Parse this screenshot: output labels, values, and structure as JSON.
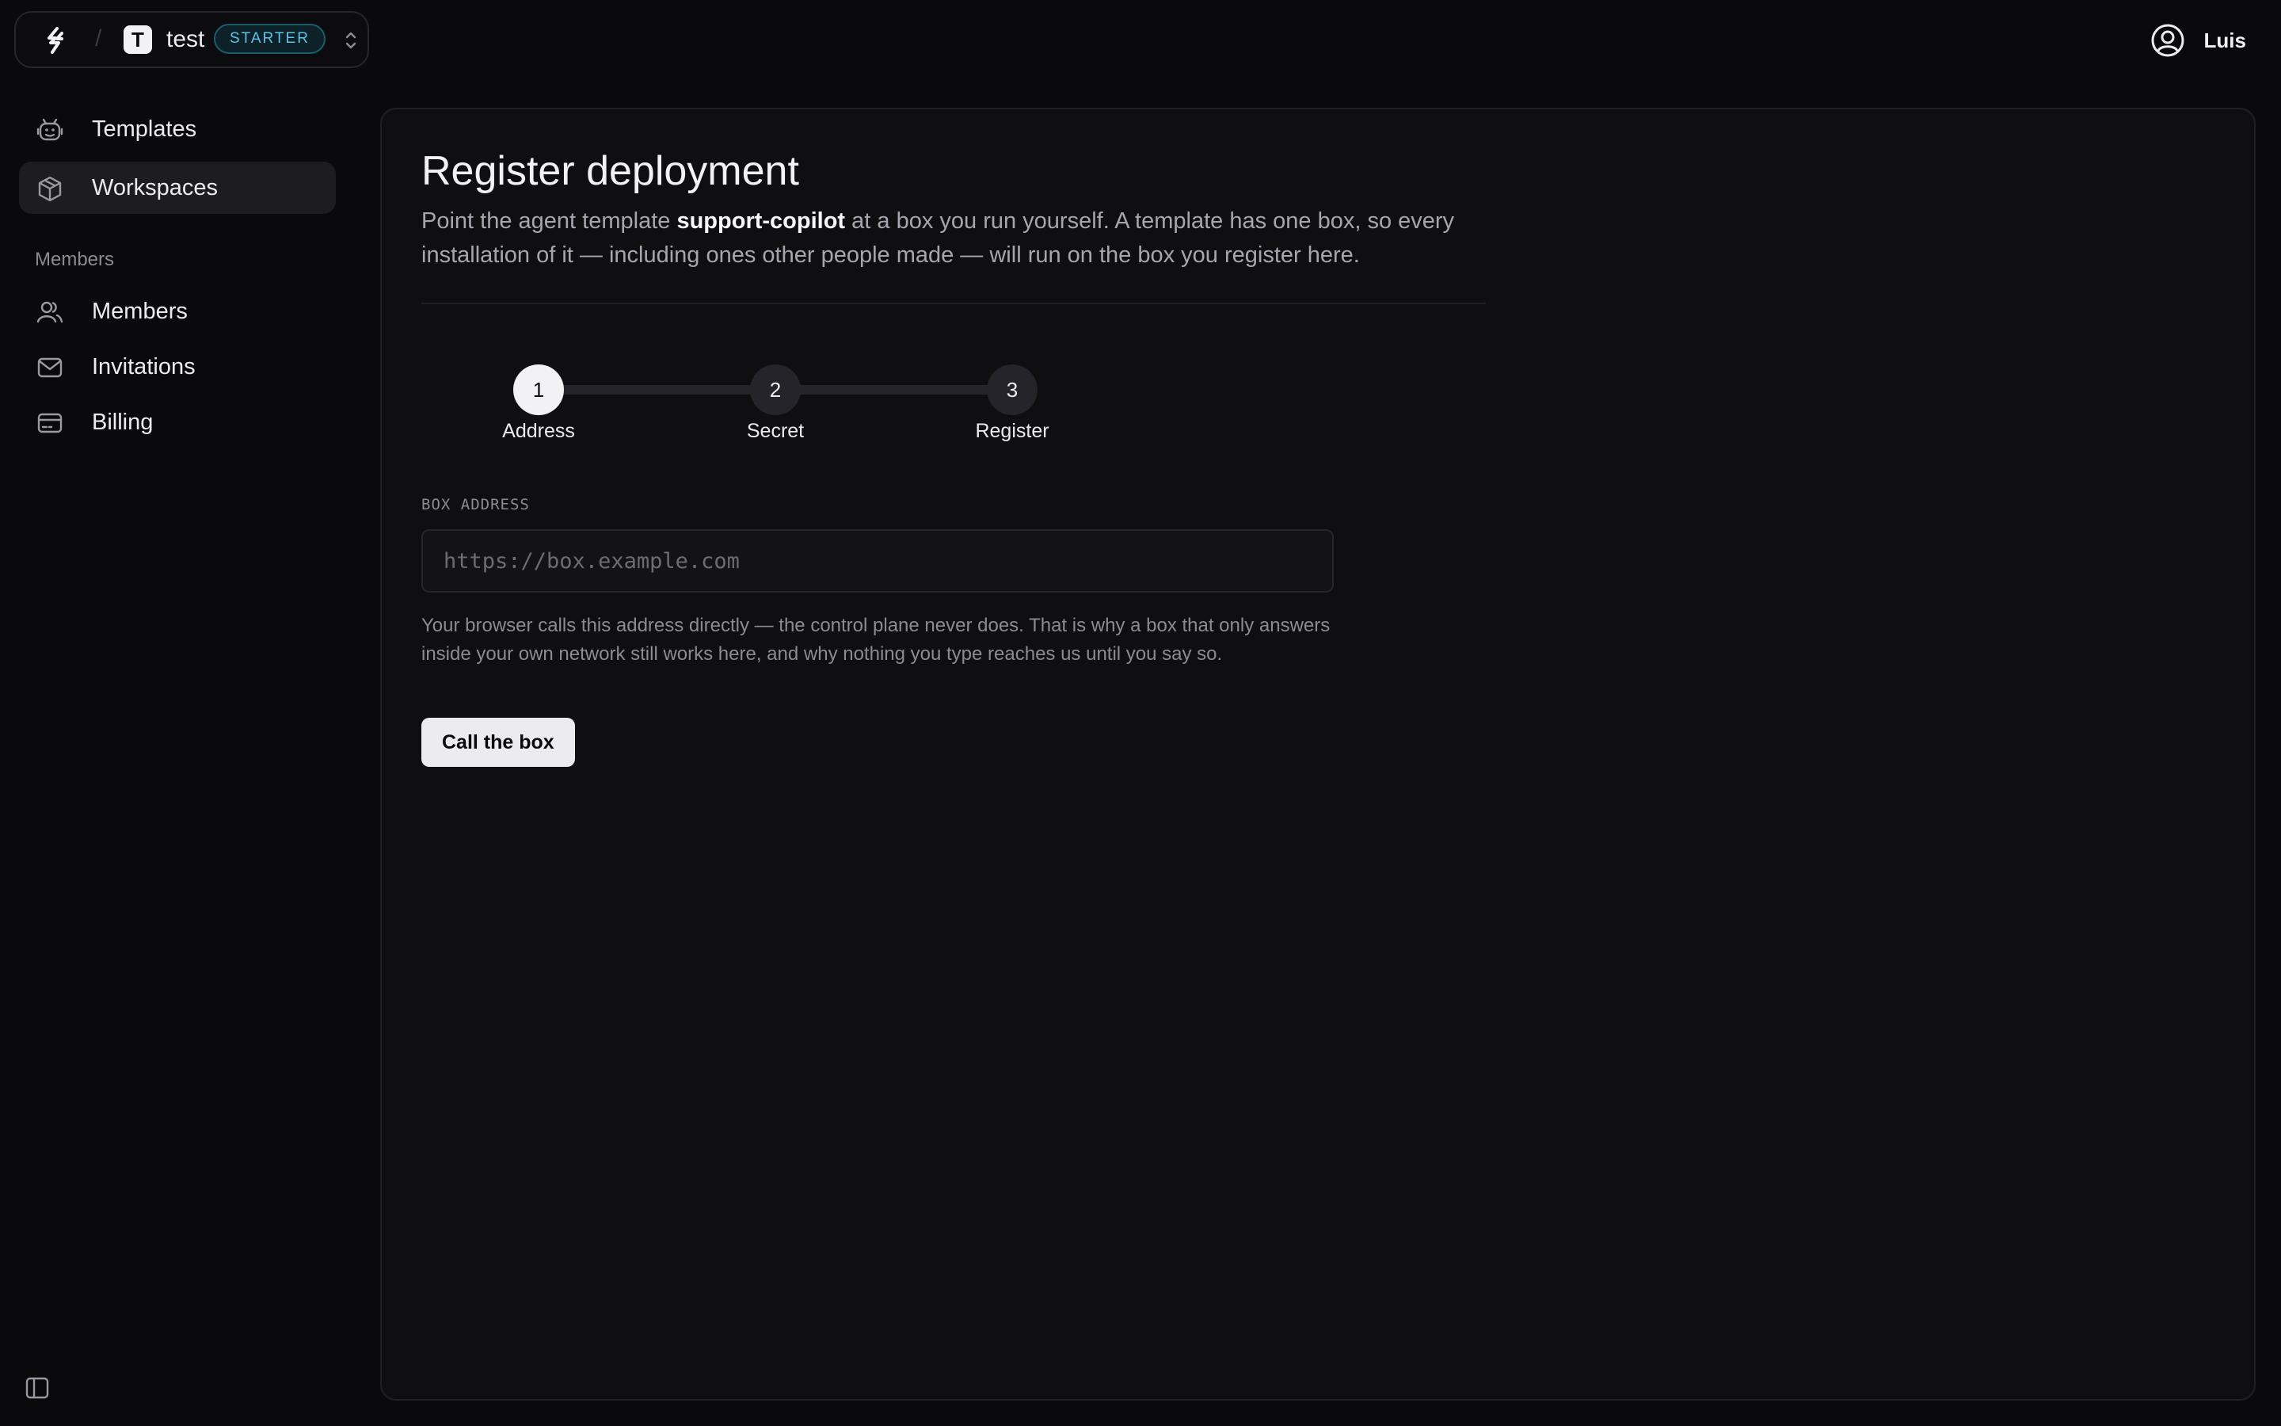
{
  "header": {
    "org_initial": "T",
    "org_name": "test",
    "plan_badge": "STARTER",
    "user_name": "Luis"
  },
  "sidebar": {
    "items": [
      {
        "label": "Templates",
        "icon": "robot-icon"
      },
      {
        "label": "Workspaces",
        "icon": "box-icon",
        "active": true
      }
    ],
    "section_label": "Members",
    "member_items": [
      {
        "label": "Members",
        "icon": "users-icon"
      },
      {
        "label": "Invitations",
        "icon": "envelope-icon"
      },
      {
        "label": "Billing",
        "icon": "credit-card-icon"
      }
    ]
  },
  "main": {
    "title": "Register deployment",
    "description_before": "Point the agent template ",
    "template_name": "support-copilot",
    "description_after": " at a box you run yourself. A template has one box, so every installation of it — including ones other people made — will run on the box you register here.",
    "steps": [
      {
        "number": "1",
        "label": "Address",
        "state": "current"
      },
      {
        "number": "2",
        "label": "Secret",
        "state": "todo"
      },
      {
        "number": "3",
        "label": "Register",
        "state": "todo"
      }
    ],
    "field_label": "BOX ADDRESS",
    "input_placeholder": "https://box.example.com",
    "input_value": "",
    "help_text": "Your browser calls this address directly — the control plane never does. That is why a box that only answers inside your own network still works here, and why nothing you type reaches us until you say so.",
    "submit_label": "Call the box"
  },
  "colors": {
    "background": "#0a0a0c",
    "panel": "#0f0f12",
    "badge_text": "#5cc4e6",
    "active_nav": "#1d1d21"
  }
}
